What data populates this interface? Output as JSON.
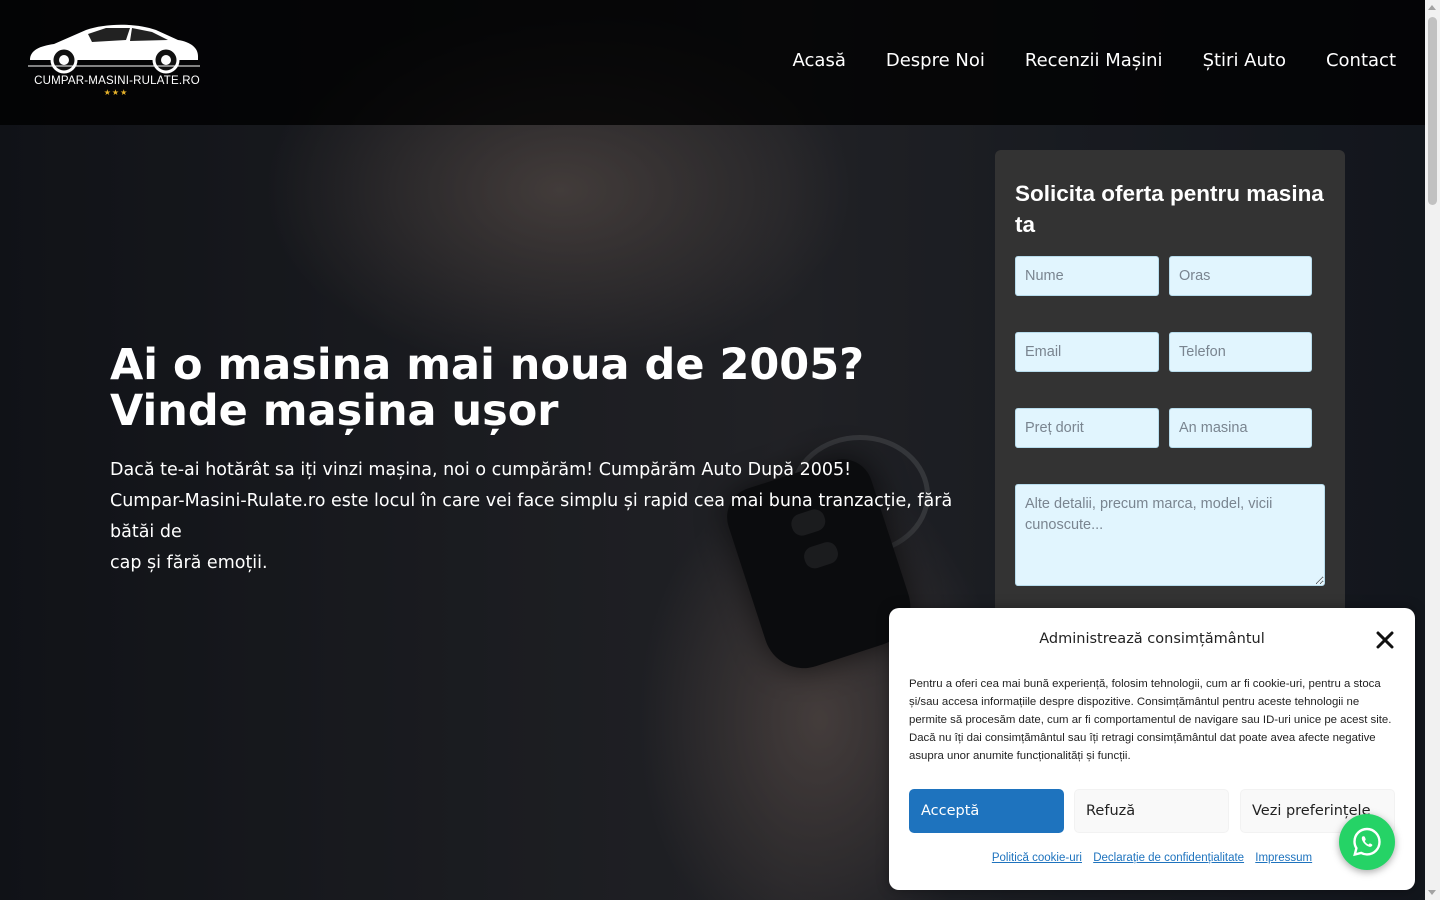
{
  "logo": {
    "text": "CUMPAR-MASINI-RULATE.RO",
    "stars": "★★★"
  },
  "nav": {
    "items": [
      {
        "label": "Acasă"
      },
      {
        "label": "Despre Noi"
      },
      {
        "label": "Recenzii Mașini"
      },
      {
        "label": "Știri Auto"
      },
      {
        "label": "Contact"
      }
    ]
  },
  "hero": {
    "title_line1": "Ai o masina mai noua de 2005?",
    "title_line2": "Vinde mașina ușor",
    "desc_line1": "Dacă te-ai hotărât sa iți vinzi mașina, noi o cumpărăm! Cumpărăm Auto După 2005!",
    "desc_line2": "Cumpar-Masini-Rulate.ro este locul în care vei face simplu și rapid cea mai buna tranzacție, fără bătăi de",
    "desc_line3": "cap și fără emoții."
  },
  "form": {
    "title": "Solicita oferta pentru masina ta",
    "fields": {
      "name_placeholder": "Nume",
      "city_placeholder": "Oras",
      "email_placeholder": "Email",
      "phone_placeholder": "Telefon",
      "price_placeholder": "Preț dorit",
      "year_placeholder": "An masina",
      "details_placeholder": "Alte detalii, precum marca, model, vicii cunoscute..."
    }
  },
  "consent": {
    "title": "Administrează consimțământul",
    "body": "Pentru a oferi cea mai bună experiență, folosim tehnologii, cum ar fi cookie-uri, pentru a stoca și/sau accesa informațiile despre dispozitive. Consimțământul pentru aceste tehnologii ne permite să procesăm date, cum ar fi comportamentul de navigare sau ID-uri unice pe acest site. Dacă nu îți dai consimțământul sau îți retragi consimțământul dat poate avea afecte negative asupra unor anumite funcționalități și funcții.",
    "accept_label": "Acceptă",
    "refuse_label": "Refuză",
    "prefs_label": "Vezi preferințele",
    "links": {
      "cookie_policy": "Politică cookie-uri",
      "privacy": "Declarație de confidențialitate",
      "impressum": "Impressum"
    }
  },
  "colors": {
    "accent": "#1e73be",
    "input_bg": "#e1f5fe",
    "form_bg": "#333333",
    "whatsapp": "#25d366"
  },
  "icons": {
    "close": "close-icon",
    "whatsapp": "whatsapp-icon",
    "logo": "car-logo-icon"
  }
}
